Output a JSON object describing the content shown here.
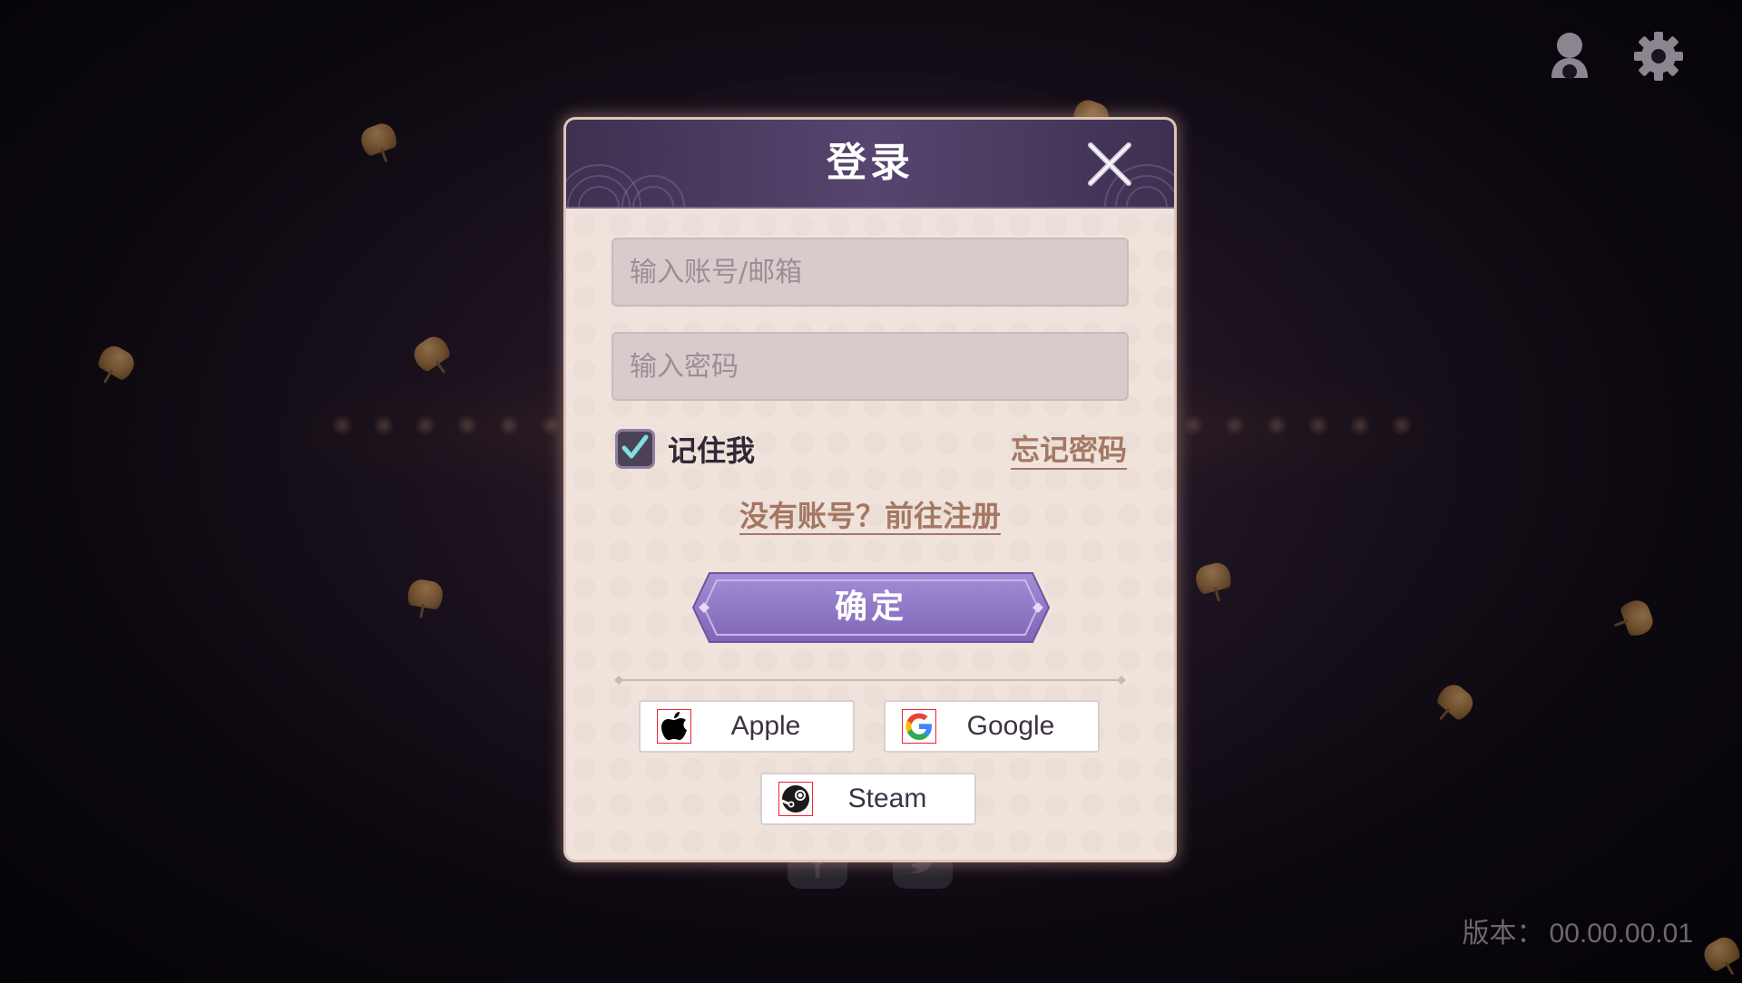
{
  "top_bar": {
    "profile_icon": "user-icon",
    "settings_icon": "gear-icon"
  },
  "dialog": {
    "title": "登录",
    "close_icon": "close-icon",
    "account_input": {
      "value": "",
      "placeholder": "输入账号/邮箱"
    },
    "password_input": {
      "value": "",
      "placeholder": "输入密码"
    },
    "remember_me": {
      "label": "记住我",
      "checked": true
    },
    "forgot_password": "忘记密码",
    "register_link": "没有账号？前往注册",
    "confirm_button": "确定",
    "social_logins": [
      {
        "label": "Apple",
        "icon": "apple-icon"
      },
      {
        "label": "Google",
        "icon": "google-icon"
      },
      {
        "label": "Steam",
        "icon": "steam-icon"
      }
    ]
  },
  "version": {
    "label": "版本：",
    "value": "00.00.00.01"
  },
  "colors": {
    "header": "#4a3c60",
    "panel": "#efe3dc",
    "accent_link": "#a57762",
    "confirm_button": "#8f78c4"
  }
}
